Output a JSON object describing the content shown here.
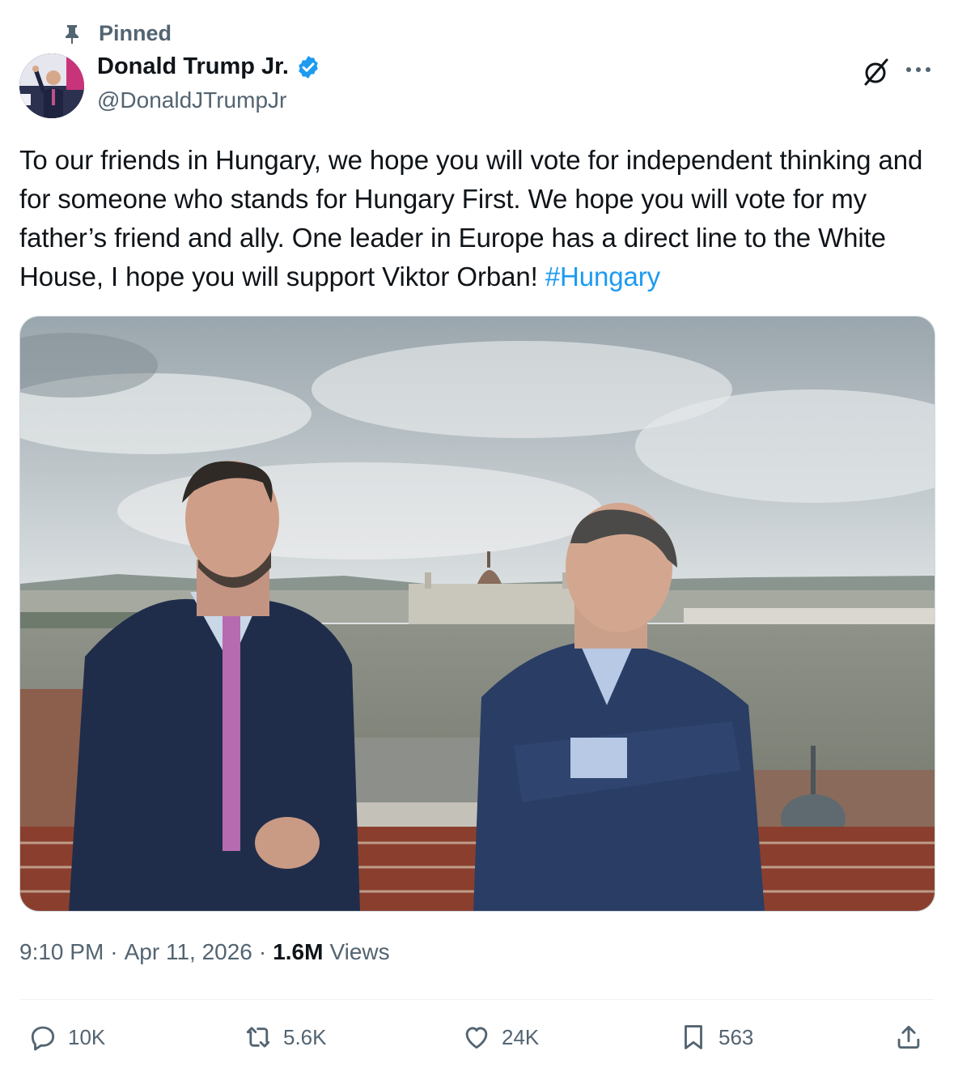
{
  "pinned": {
    "label": "Pinned",
    "icon": "pin-icon"
  },
  "author": {
    "display_name": "Donald Trump Jr.",
    "handle": "@DonaldJTrumpJr",
    "verified_icon": "verified-badge-icon",
    "verified_color": "#1d9bf0"
  },
  "header_actions": {
    "grok_icon": "grok-icon",
    "more_icon": "more-icon"
  },
  "tweet": {
    "text": "To our friends in Hungary, we hope you will vote for independent thinking and for someone who stands for Hungary First. We hope you will vote for my father’s friend and ally. One leader in Europe has a direct line to the White House, I hope you will support Viktor Orban! ",
    "hashtag": "#Hungary",
    "hashtag_color": "#1d9bf0"
  },
  "media": {
    "alt_description_icon": "photo"
  },
  "meta": {
    "time": "9:10 PM",
    "separator": "·",
    "date": "Apr 11, 2026",
    "views_count": "1.6M",
    "views_label": "Views"
  },
  "actions": {
    "reply_count": "10K",
    "repost_count": "5.6K",
    "like_count": "24K",
    "bookmark_count": "563"
  },
  "colors": {
    "text_primary": "#0f1419",
    "text_secondary": "#536471",
    "accent": "#1d9bf0"
  }
}
